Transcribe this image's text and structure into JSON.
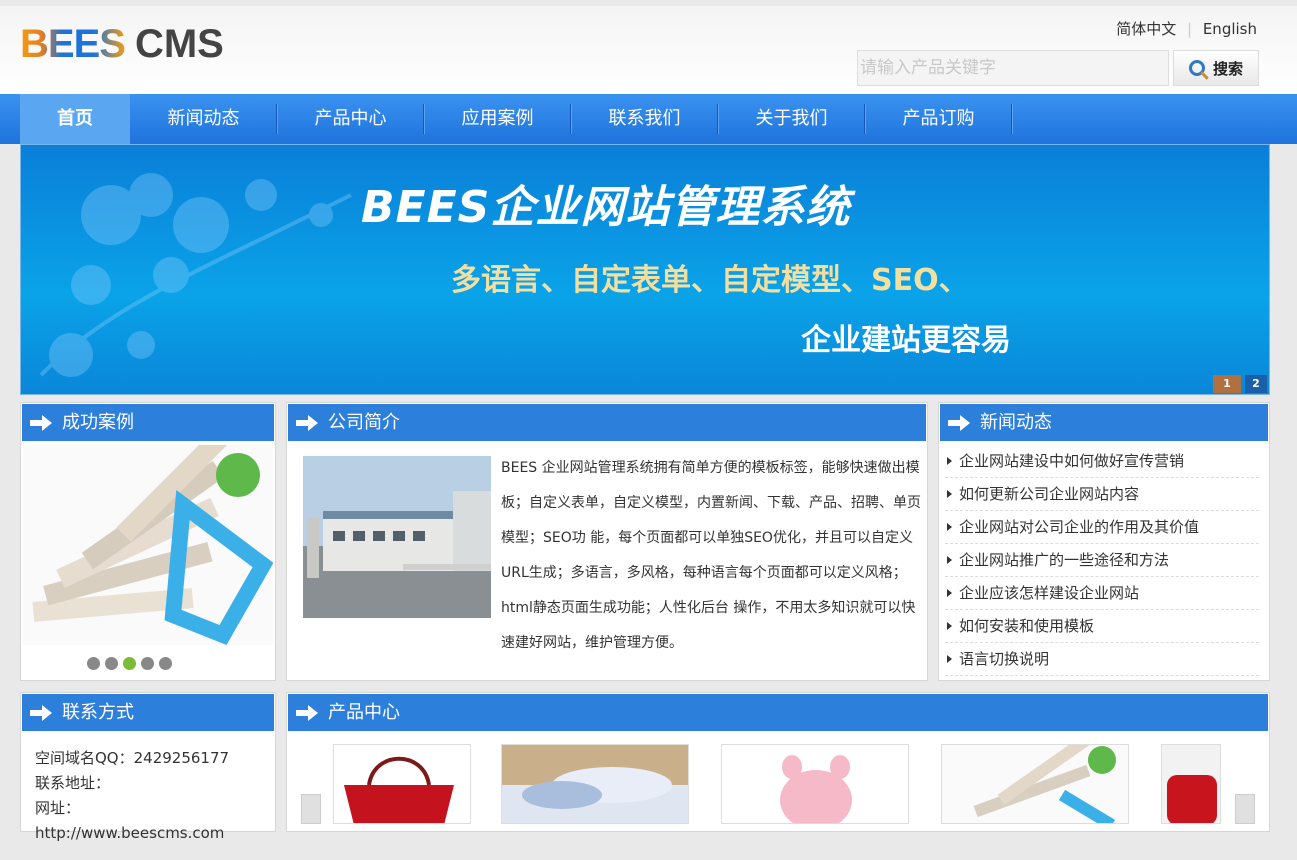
{
  "header": {
    "logo_bees": "BEES",
    "logo_cms": "CMS",
    "lang_zh": "简体中文",
    "lang_en": "English",
    "search_placeholder": "请输入产品关键字",
    "search_button": "搜索"
  },
  "nav": [
    "首页",
    "新闻动态",
    "产品中心",
    "应用案例",
    "联系我们",
    "关于我们",
    "产品订购"
  ],
  "banner": {
    "title": "BEES企业网站管理系统",
    "subtitle1": "多语言、自定表单、自定模型、SEO、",
    "subtitle2": "企业建站更容易",
    "dots": [
      "1",
      "2"
    ]
  },
  "cases": {
    "title": "成功案例"
  },
  "intro": {
    "title": "公司简介",
    "text": "BEES 企业网站管理系统拥有简单方便的模板标签，能够快速做出模板；自定义表单，自定义模型，内置新闻、下载、产品、招聘、单页模型；SEO功 能，每个页面都可以单独SEO优化，并且可以自定义URL生成；多语言，多风格，每种语言每个页面都可以定义风格；html静态页面生成功能；人性化后台 操作，不用太多知识就可以快速建好网站，维护管理方便。"
  },
  "news": {
    "title": "新闻动态",
    "items": [
      "企业网站建设中如何做好宣传营销",
      "如何更新公司企业网站内容",
      "企业网站对公司企业的作用及其价值",
      "企业网站推广的一些途径和方法",
      "企业应该怎样建设企业网站",
      "如何安装和使用模板",
      "语言切换说明"
    ]
  },
  "contact": {
    "title": "联系方式",
    "qq": "空间域名QQ：2429256177",
    "address": "联系地址：",
    "url": "网址：http://www.beescms.com"
  },
  "products": {
    "title": "产品中心"
  }
}
